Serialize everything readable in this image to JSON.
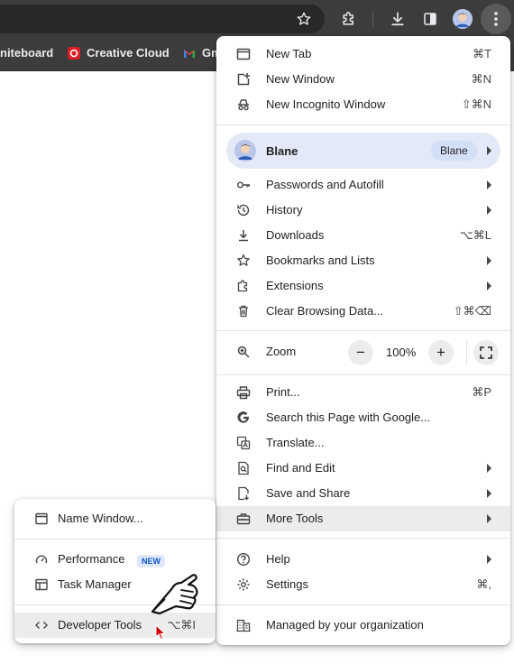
{
  "bookmarks_bar": {
    "items": [
      {
        "label": "niteboard"
      },
      {
        "label": "Creative Cloud"
      },
      {
        "label": "Gm"
      }
    ]
  },
  "main_menu": {
    "new_tab": {
      "label": "New Tab",
      "shortcut": "⌘T"
    },
    "new_window": {
      "label": "New Window",
      "shortcut": "⌘N"
    },
    "new_incognito": {
      "label": "New Incognito Window",
      "shortcut": "⇧⌘N"
    },
    "profile": {
      "name": "Blane",
      "chip": "Blane"
    },
    "passwords": {
      "label": "Passwords and Autofill"
    },
    "history": {
      "label": "History"
    },
    "downloads": {
      "label": "Downloads",
      "shortcut": "⌥⌘L"
    },
    "bookmarks": {
      "label": "Bookmarks and Lists"
    },
    "extensions": {
      "label": "Extensions"
    },
    "clear_data": {
      "label": "Clear Browsing Data...",
      "shortcut": "⇧⌘⌫"
    },
    "zoom": {
      "label": "Zoom",
      "value": "100%",
      "minus": "−",
      "plus": "+"
    },
    "print": {
      "label": "Print...",
      "shortcut": "⌘P"
    },
    "search_page": {
      "label": "Search this Page with Google..."
    },
    "translate": {
      "label": "Translate..."
    },
    "find_edit": {
      "label": "Find and Edit"
    },
    "save_share": {
      "label": "Save and Share"
    },
    "more_tools": {
      "label": "More Tools"
    },
    "help": {
      "label": "Help"
    },
    "settings": {
      "label": "Settings",
      "shortcut": "⌘,"
    },
    "managed": {
      "label": "Managed by your organization"
    }
  },
  "more_tools_menu": {
    "name_window": {
      "label": "Name Window..."
    },
    "performance": {
      "label": "Performance",
      "badge": "NEW"
    },
    "task_manager": {
      "label": "Task Manager"
    },
    "developer_tools": {
      "label": "Developer Tools",
      "shortcut": "⌥⌘I"
    }
  },
  "colors": {
    "chrome_dark": "#3c3c3c",
    "menu_highlight": "#ececec",
    "profile_row": "#e4e9f7",
    "badge_text": "#0b57d0"
  }
}
